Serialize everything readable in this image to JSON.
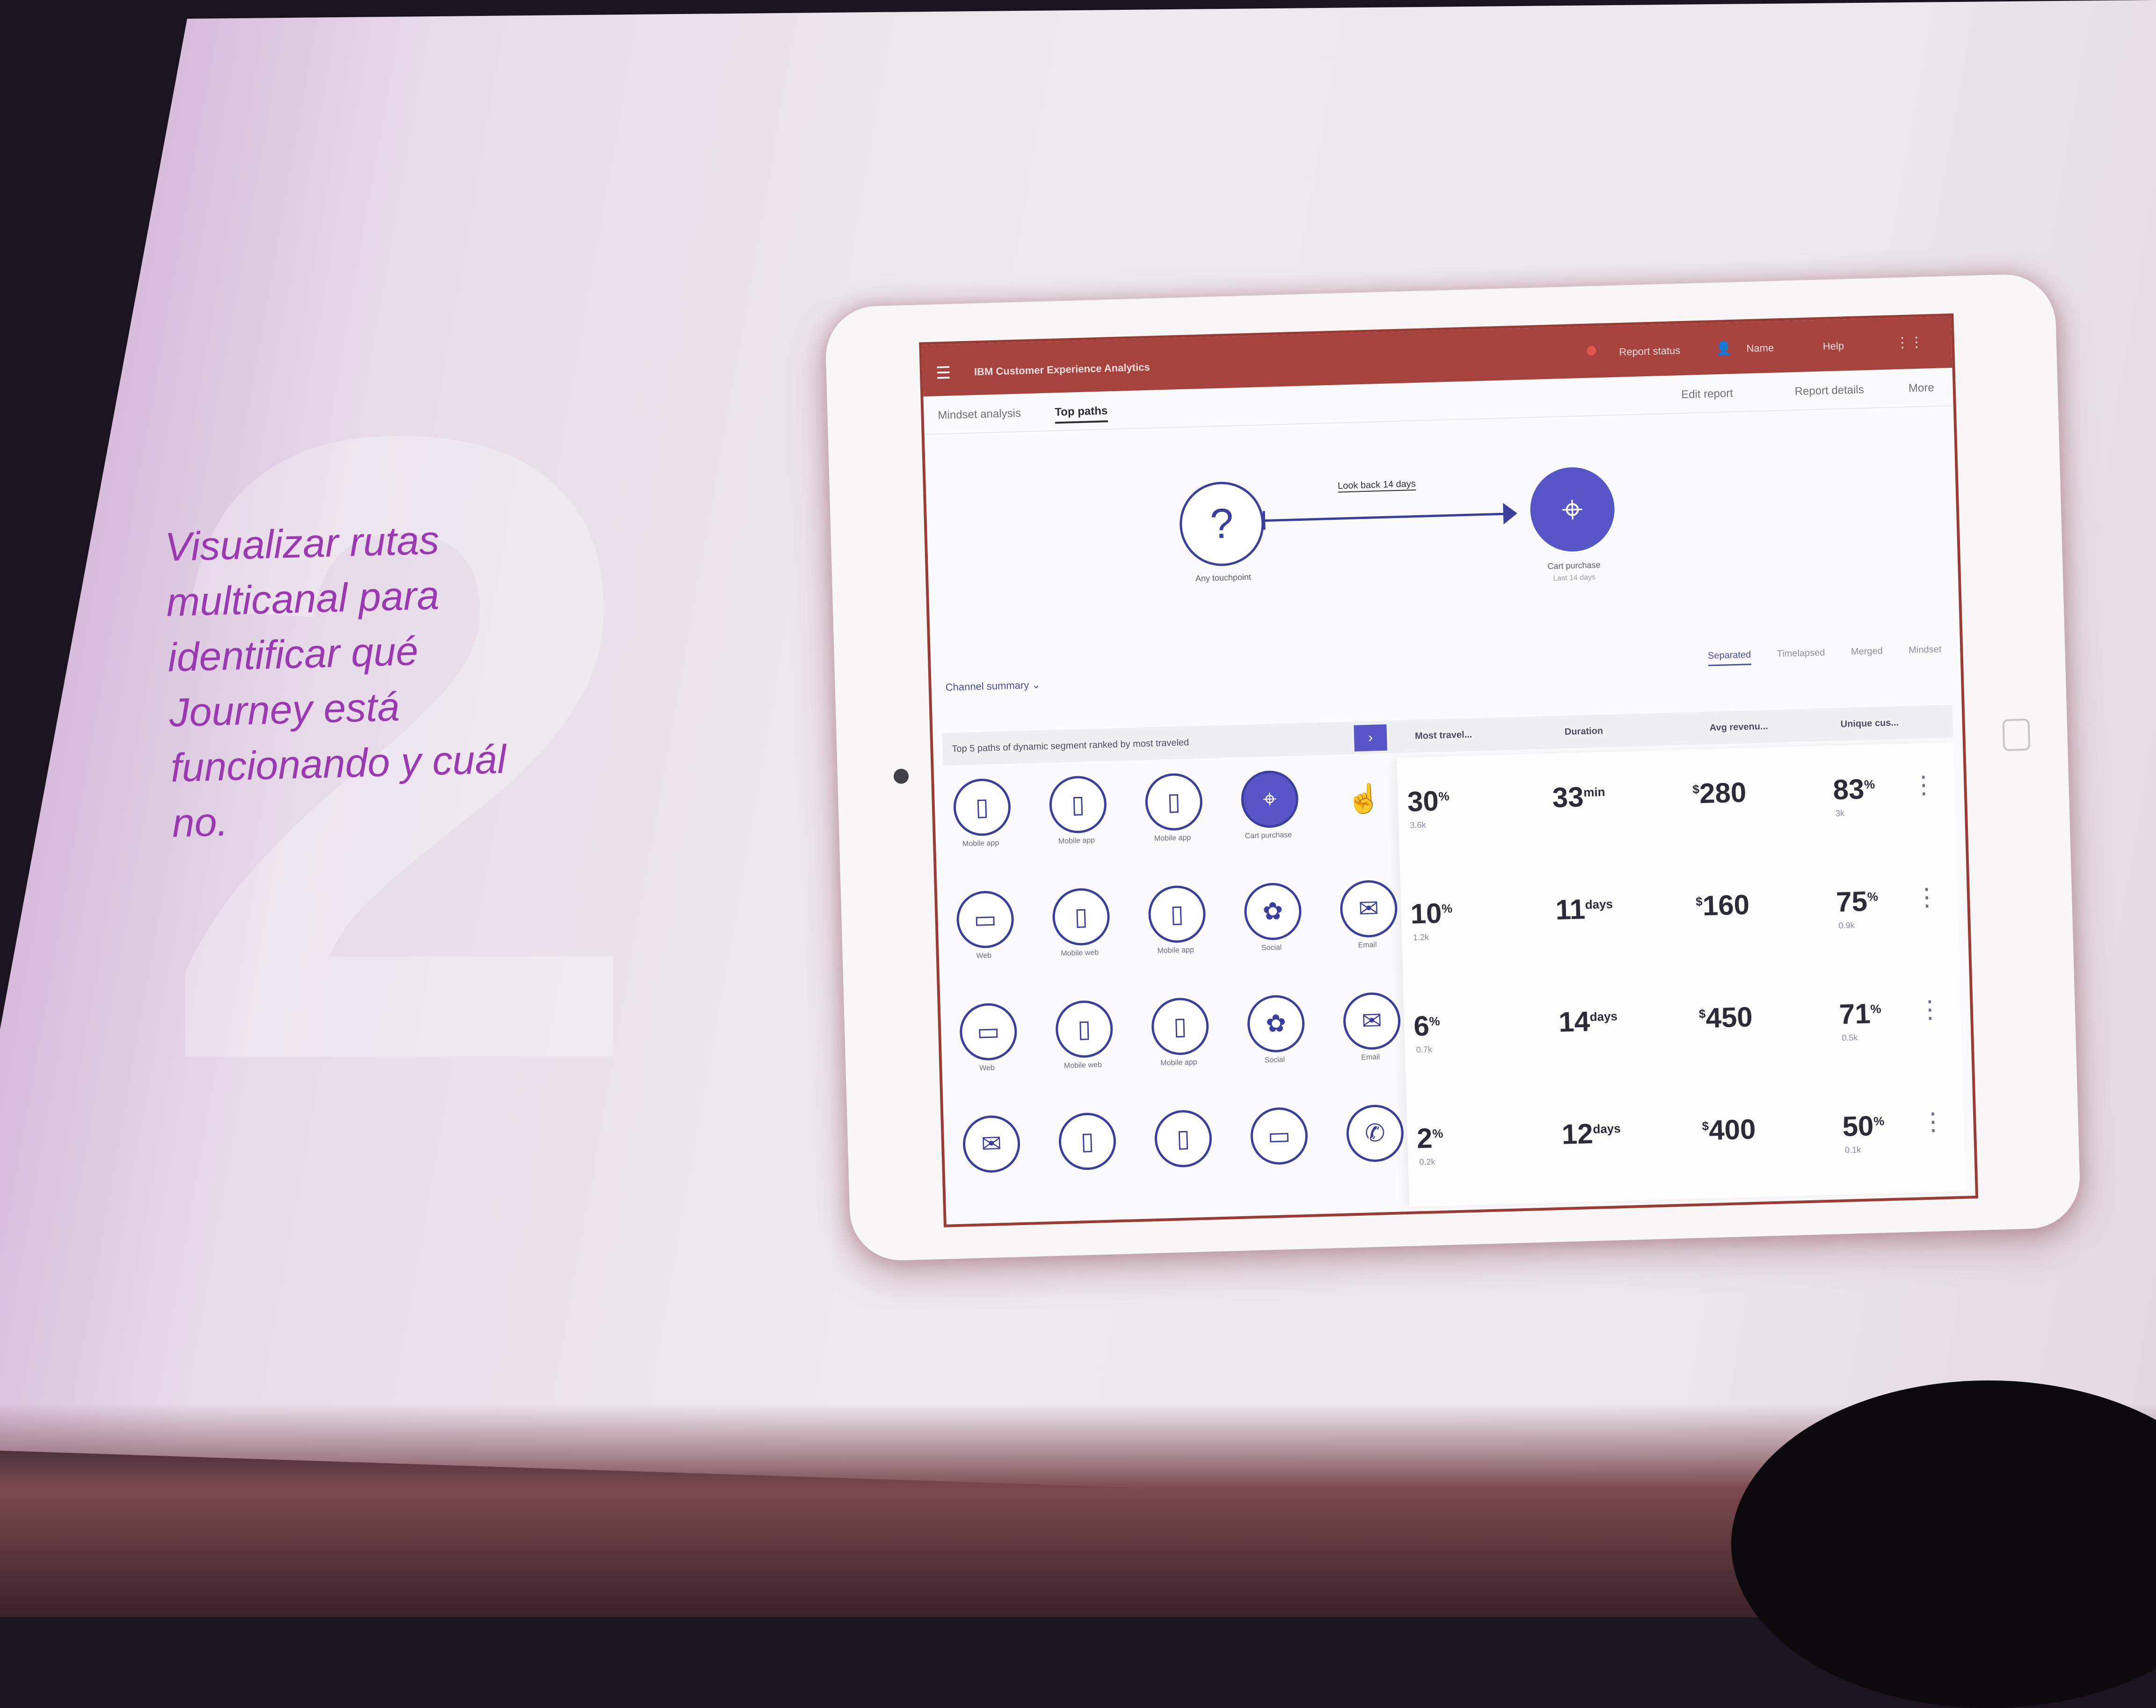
{
  "slide": {
    "tagline": [
      "Visualizar rutas",
      "multicanal para",
      "identificar qué",
      "Journey está",
      "funcionando y cuál",
      "no."
    ]
  },
  "app": {
    "title": "IBM Customer Experience Analytics",
    "menu_icon": "hamburger-icon",
    "status": "Report status",
    "user": "Name",
    "help": "Help"
  },
  "subnav": {
    "crumb_parent": "Mindset analysis",
    "crumb_current": "Top paths",
    "edit": "Edit report",
    "details": "Report details",
    "more": "More"
  },
  "flow": {
    "start_label": "Any touchpoint",
    "lookback": "Look back 14 days",
    "end_label": "Cart purchase",
    "end_sub": "Last 14 days"
  },
  "summary_dropdown": "Channel summary",
  "view_tabs": [
    "Separated",
    "Timelapsed",
    "Merged",
    "Mindset"
  ],
  "table": {
    "description": "Top 5 paths of dynamic segment ranked by most traveled",
    "columns": [
      "Most travel...",
      "Duration",
      "Avg revenu...",
      "Unique cus..."
    ],
    "rows": [
      {
        "nodes": [
          {
            "icon": "mobile-app-icon",
            "glyph": "▯",
            "label": "Mobile app"
          },
          {
            "icon": "mobile-app-icon",
            "glyph": "▯",
            "label": "Mobile app"
          },
          {
            "icon": "mobile-app-icon",
            "glyph": "▯",
            "label": "Mobile app"
          },
          {
            "icon": "location-pin-icon",
            "glyph": "⌖",
            "label": "Cart purchase",
            "dest": true
          }
        ],
        "pct": "30",
        "pct_sub": "3.6k",
        "duration": "33",
        "duration_unit": "min",
        "revenue": "280",
        "unique": "83",
        "unique_sub": "3k"
      },
      {
        "nodes": [
          {
            "icon": "web-icon",
            "glyph": "▭",
            "label": "Web"
          },
          {
            "icon": "mobile-web-icon",
            "glyph": "▯",
            "label": "Mobile web"
          },
          {
            "icon": "mobile-app-icon",
            "glyph": "▯",
            "label": "Mobile app"
          },
          {
            "icon": "social-icon",
            "glyph": "✿",
            "label": "Social"
          },
          {
            "icon": "email-icon",
            "glyph": "✉",
            "label": "Email"
          }
        ],
        "pct": "10",
        "pct_sub": "1.2k",
        "duration": "11",
        "duration_unit": "days",
        "revenue": "160",
        "unique": "75",
        "unique_sub": "0.9k"
      },
      {
        "nodes": [
          {
            "icon": "web-icon",
            "glyph": "▭",
            "label": "Web"
          },
          {
            "icon": "mobile-web-icon",
            "glyph": "▯",
            "label": "Mobile web"
          },
          {
            "icon": "mobile-app-icon",
            "glyph": "▯",
            "label": "Mobile app"
          },
          {
            "icon": "social-icon",
            "glyph": "✿",
            "label": "Social"
          },
          {
            "icon": "email-icon",
            "glyph": "✉",
            "label": "Email"
          }
        ],
        "pct": "6",
        "pct_sub": "0.7k",
        "duration": "14",
        "duration_unit": "days",
        "revenue": "450",
        "unique": "71",
        "unique_sub": "0.5k"
      },
      {
        "nodes": [
          {
            "icon": "email-icon",
            "glyph": "✉",
            "label": ""
          },
          {
            "icon": "mobile-transfer-icon",
            "glyph": "▯",
            "label": ""
          },
          {
            "icon": "mobile-app-icon",
            "glyph": "▯",
            "label": ""
          },
          {
            "icon": "web-icon",
            "glyph": "▭",
            "label": ""
          },
          {
            "icon": "phone-icon",
            "glyph": "✆",
            "label": ""
          }
        ],
        "pct": "2",
        "pct_sub": "0.2k",
        "duration": "12",
        "duration_unit": "days",
        "revenue": "400",
        "unique": "50",
        "unique_sub": "0.1k"
      }
    ]
  },
  "colors": {
    "topbar": "#a6433e",
    "accent": "#5856c7",
    "tagline": "#9a3ab0"
  }
}
